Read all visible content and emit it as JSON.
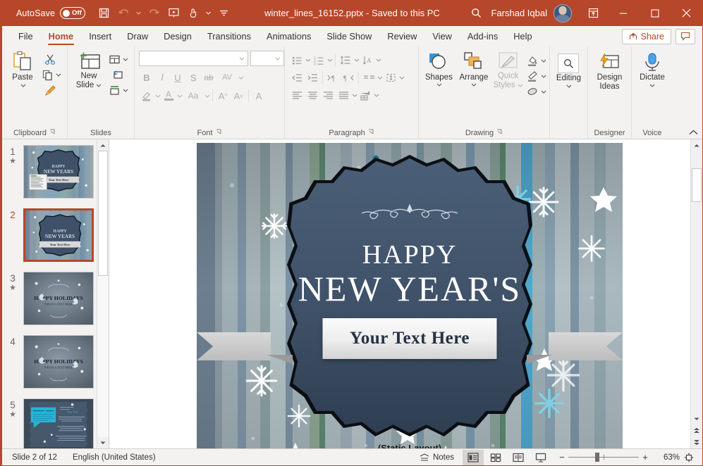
{
  "titlebar": {
    "autosave_label": "AutoSave",
    "autosave_state": "Off",
    "filename": "winter_lines_16152.pptx",
    "separator": "-",
    "saved_state": "Saved to this PC",
    "user_name": "Farshad Iqbal",
    "icons": [
      "save-icon",
      "undo-icon",
      "redo-icon",
      "start-presentation-icon",
      "touch-mode-icon",
      "customize-quick-access-icon"
    ],
    "search_icon": "search-icon",
    "ribbon_display_icon": "ribbon-display-options-icon",
    "minimize_icon": "minimize-icon",
    "maximize_icon": "maximize-icon",
    "close_icon": "close-icon"
  },
  "tabs": [
    {
      "label": "File",
      "active": false
    },
    {
      "label": "Home",
      "active": true
    },
    {
      "label": "Insert",
      "active": false
    },
    {
      "label": "Draw",
      "active": false
    },
    {
      "label": "Design",
      "active": false
    },
    {
      "label": "Transitions",
      "active": false
    },
    {
      "label": "Animations",
      "active": false
    },
    {
      "label": "Slide Show",
      "active": false
    },
    {
      "label": "Review",
      "active": false
    },
    {
      "label": "View",
      "active": false
    },
    {
      "label": "Add-ins",
      "active": false
    },
    {
      "label": "Help",
      "active": false
    }
  ],
  "tabbar_right": {
    "share_label": "Share",
    "share_icon": "share-icon",
    "comments_icon": "comments-icon"
  },
  "ribbon": {
    "groups": [
      {
        "name": "Clipboard",
        "label": "Clipboard",
        "has_launcher": true
      },
      {
        "name": "Slides",
        "label": "Slides",
        "has_launcher": false
      },
      {
        "name": "Font",
        "label": "Font",
        "has_launcher": true
      },
      {
        "name": "Paragraph",
        "label": "Paragraph",
        "has_launcher": true
      },
      {
        "name": "Drawing",
        "label": "Drawing",
        "has_launcher": true
      },
      {
        "name": "Designer",
        "label": "Designer",
        "has_launcher": false
      },
      {
        "name": "Voice",
        "label": "Voice",
        "has_launcher": false
      }
    ],
    "clipboard": {
      "paste_label": "Paste",
      "cut_icon": "cut-icon",
      "copy_icon": "copy-icon",
      "format_painter_icon": "format-painter-icon"
    },
    "slides": {
      "new_slide_label": "New\nSlide",
      "new_slide_line1": "New",
      "new_slide_line2": "Slide",
      "layout_icon": "slide-layout-icon",
      "reset_icon": "reset-slide-icon",
      "section_icon": "section-icon"
    },
    "font": {
      "font_name_value": "",
      "font_size_value": "",
      "bold_label": "B",
      "italic_label": "I",
      "underline_label": "U",
      "shadow_label": "S",
      "strikethrough_label": "ab",
      "char_spacing_label": "AV",
      "text_highlight_icon": "text-highlight-color-icon",
      "font_color_label": "A",
      "change_case_label": "Aa",
      "increase_size_label": "A",
      "decrease_size_label": "A",
      "clear_formatting_label": "A"
    },
    "paragraph": {
      "bullets_icon": "bullets-icon",
      "numbering_icon": "numbering-icon",
      "line_spacing_icon": "line-spacing-icon",
      "text_direction_icon": "text-direction-icon",
      "decrease_indent_icon": "decrease-indent-icon",
      "increase_indent_icon": "increase-indent-icon",
      "ltr_icon": "left-to-right-icon",
      "rtl_icon": "right-to-left-icon",
      "columns_icon": "columns-icon",
      "align_text_icon": "align-text-icon",
      "align_left_icon": "align-left-icon",
      "align_center_icon": "align-center-icon",
      "align_right_icon": "align-right-icon",
      "justify_icon": "justify-icon",
      "smartart_icon": "convert-to-smartart-icon"
    },
    "drawing": {
      "shapes_label": "Shapes",
      "arrange_label": "Arrange",
      "quick_styles_line1": "Quick",
      "quick_styles_line2": "Styles",
      "shape_fill_icon": "shape-fill-icon",
      "shape_outline_icon": "shape-outline-icon",
      "shape_effects_icon": "shape-effects-icon"
    },
    "editing": {
      "label": "Editing",
      "icon": "find-icon"
    },
    "designer": {
      "line1": "Design",
      "line2": "Ideas",
      "icon": "design-ideas-icon"
    },
    "voice": {
      "label": "Dictate",
      "icon": "microphone-icon"
    },
    "collapse_icon": "collapse-ribbon-icon"
  },
  "thumbnails": {
    "scroll_up_icon": "scroll-up-icon",
    "scroll_down_icon": "scroll-down-icon",
    "slides": [
      {
        "number": "1",
        "has_animation": true,
        "selected": false,
        "type": "newyears-with-textbox"
      },
      {
        "number": "2",
        "has_animation": false,
        "selected": true,
        "type": "newyears"
      },
      {
        "number": "3",
        "has_animation": true,
        "selected": false,
        "type": "holidays"
      },
      {
        "number": "4",
        "has_animation": false,
        "selected": false,
        "type": "holidays"
      },
      {
        "number": "5",
        "has_animation": true,
        "selected": false,
        "type": "content"
      }
    ]
  },
  "slide": {
    "title_line1": "HAPPY",
    "title_line2": "NEW YEAR'S",
    "banner_text": "Your Text Here",
    "footer_note": "(Static Layout)"
  },
  "editor_scroll": {
    "up_icon": "scroll-up-icon",
    "down_icon": "scroll-down-icon",
    "previous_slide_icon": "previous-slide-icon",
    "next_slide_icon": "next-slide-icon"
  },
  "status": {
    "slide_indicator": "Slide 2 of 12",
    "language": "English (United States)",
    "notes_label": "Notes",
    "notes_icon": "notes-icon",
    "views": [
      {
        "name": "normal-view",
        "icon": "normal-view-icon",
        "active": true
      },
      {
        "name": "slide-sorter-view",
        "icon": "slide-sorter-icon",
        "active": false
      },
      {
        "name": "reading-view",
        "icon": "reading-view-icon",
        "active": false
      },
      {
        "name": "slide-show-view",
        "icon": "slide-show-icon",
        "active": false
      }
    ],
    "zoom_out_label": "−",
    "zoom_in_label": "+",
    "zoom_value": "63%",
    "fit_icon": "fit-slide-to-window-icon"
  },
  "colors": {
    "accent": "#b7472a",
    "ribbon_bg": "#f3f2f1",
    "badge": "#3f5168",
    "slide_text": "#ffffff"
  }
}
